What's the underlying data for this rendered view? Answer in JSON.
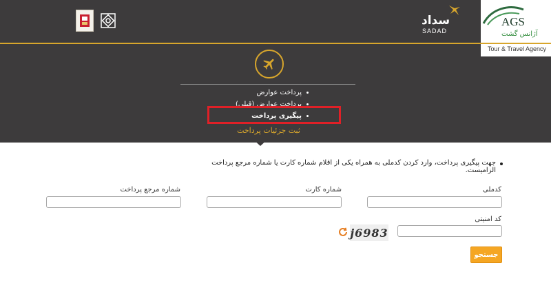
{
  "brand": {
    "sadad_fa": "سداد",
    "sadad_en": "SADAD",
    "agency_title": "AGS",
    "agency_fa": "آژانس گشت",
    "agency_en": "Tour & Travel Agency"
  },
  "menu": {
    "items": [
      {
        "label": "پرداخت عوارض"
      },
      {
        "label": "پرداخت عوارض (قبلی)"
      },
      {
        "label": "پیگیری پرداخت"
      }
    ],
    "subtitle": "ثبت جزئیات پرداخت"
  },
  "form": {
    "note": "جهت پیگیری پرداخت، وارد کردن کدملی به همراه یکی از اقلام شماره کارت یا شماره مرجع پرداخت الزامیست.",
    "national_code_label": "کدملی",
    "card_number_label": "شماره کارت",
    "ref_number_label": "شماره مرجع پرداخت",
    "security_code_label": "کد امنیتی",
    "captcha_text": "j6983",
    "search_label": "جستجو"
  },
  "colors": {
    "header_bg": "#3d3b3c",
    "accent": "#d8a62c",
    "highlight": "#e02027",
    "button": "#f5a623"
  }
}
